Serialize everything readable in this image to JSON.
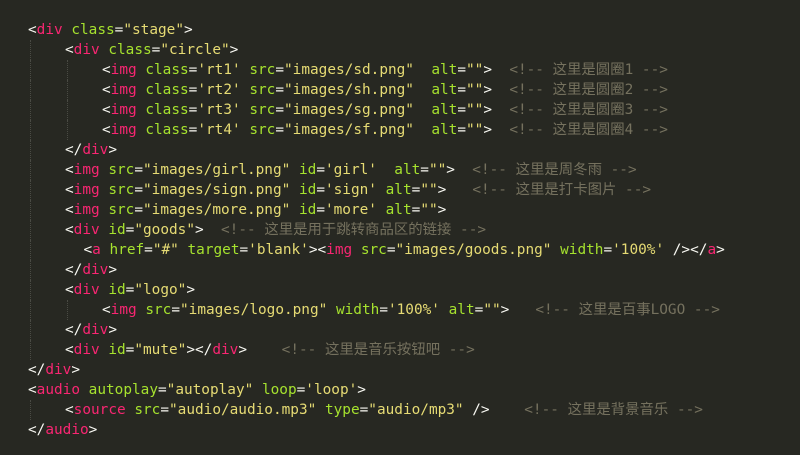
{
  "editor": {
    "language": "html",
    "theme": "monokai",
    "colors": {
      "background": "#272822",
      "tag": "#f92672",
      "attribute": "#a6e22e",
      "string": "#e6db74",
      "comment": "#75715e",
      "text": "#f8f8f2"
    },
    "lines": [
      {
        "indent": 0,
        "tokens": [
          [
            "punc",
            "<"
          ],
          [
            "tag",
            "div"
          ],
          [
            "punc",
            " "
          ],
          [
            "attr",
            "class"
          ],
          [
            "punc",
            "="
          ],
          [
            "str",
            "\"stage\""
          ],
          [
            "punc",
            ">"
          ]
        ]
      },
      {
        "indent": 1,
        "tokens": [
          [
            "punc",
            "<"
          ],
          [
            "tag",
            "div"
          ],
          [
            "punc",
            " "
          ],
          [
            "attr",
            "class"
          ],
          [
            "punc",
            "="
          ],
          [
            "str",
            "\"circle\""
          ],
          [
            "punc",
            ">"
          ]
        ]
      },
      {
        "indent": 2,
        "tokens": [
          [
            "punc",
            "<"
          ],
          [
            "tag",
            "img"
          ],
          [
            "punc",
            " "
          ],
          [
            "attr",
            "class"
          ],
          [
            "punc",
            "="
          ],
          [
            "str",
            "'rt1'"
          ],
          [
            "punc",
            " "
          ],
          [
            "attr",
            "src"
          ],
          [
            "punc",
            "="
          ],
          [
            "str",
            "\"images/sd.png\""
          ],
          [
            "punc",
            "  "
          ],
          [
            "attr",
            "alt"
          ],
          [
            "punc",
            "="
          ],
          [
            "str",
            "\"\""
          ],
          [
            "punc",
            ">"
          ],
          [
            "punc",
            "  "
          ],
          [
            "cmt",
            "<!-- 这里是圆圈1 -->"
          ]
        ]
      },
      {
        "indent": 2,
        "tokens": [
          [
            "punc",
            "<"
          ],
          [
            "tag",
            "img"
          ],
          [
            "punc",
            " "
          ],
          [
            "attr",
            "class"
          ],
          [
            "punc",
            "="
          ],
          [
            "str",
            "'rt2'"
          ],
          [
            "punc",
            " "
          ],
          [
            "attr",
            "src"
          ],
          [
            "punc",
            "="
          ],
          [
            "str",
            "\"images/sh.png\""
          ],
          [
            "punc",
            "  "
          ],
          [
            "attr",
            "alt"
          ],
          [
            "punc",
            "="
          ],
          [
            "str",
            "\"\""
          ],
          [
            "punc",
            ">"
          ],
          [
            "punc",
            "  "
          ],
          [
            "cmt",
            "<!-- 这里是圆圈2 -->"
          ]
        ]
      },
      {
        "indent": 2,
        "tokens": [
          [
            "punc",
            "<"
          ],
          [
            "tag",
            "img"
          ],
          [
            "punc",
            " "
          ],
          [
            "attr",
            "class"
          ],
          [
            "punc",
            "="
          ],
          [
            "str",
            "'rt3'"
          ],
          [
            "punc",
            " "
          ],
          [
            "attr",
            "src"
          ],
          [
            "punc",
            "="
          ],
          [
            "str",
            "\"images/sg.png\""
          ],
          [
            "punc",
            "  "
          ],
          [
            "attr",
            "alt"
          ],
          [
            "punc",
            "="
          ],
          [
            "str",
            "\"\""
          ],
          [
            "punc",
            ">"
          ],
          [
            "punc",
            "  "
          ],
          [
            "cmt",
            "<!-- 这里是圆圈3 -->"
          ]
        ]
      },
      {
        "indent": 2,
        "tokens": [
          [
            "punc",
            "<"
          ],
          [
            "tag",
            "img"
          ],
          [
            "punc",
            " "
          ],
          [
            "attr",
            "class"
          ],
          [
            "punc",
            "="
          ],
          [
            "str",
            "'rt4'"
          ],
          [
            "punc",
            " "
          ],
          [
            "attr",
            "src"
          ],
          [
            "punc",
            "="
          ],
          [
            "str",
            "\"images/sf.png\""
          ],
          [
            "punc",
            "  "
          ],
          [
            "attr",
            "alt"
          ],
          [
            "punc",
            "="
          ],
          [
            "str",
            "\"\""
          ],
          [
            "punc",
            ">"
          ],
          [
            "punc",
            "  "
          ],
          [
            "cmt",
            "<!-- 这里是圆圈4 -->"
          ]
        ]
      },
      {
        "indent": 1,
        "tokens": [
          [
            "punc",
            "</"
          ],
          [
            "tag",
            "div"
          ],
          [
            "punc",
            ">"
          ]
        ]
      },
      {
        "indent": 1,
        "tokens": [
          [
            "punc",
            "<"
          ],
          [
            "tag",
            "img"
          ],
          [
            "punc",
            " "
          ],
          [
            "attr",
            "src"
          ],
          [
            "punc",
            "="
          ],
          [
            "str",
            "\"images/girl.png\""
          ],
          [
            "punc",
            " "
          ],
          [
            "attr",
            "id"
          ],
          [
            "punc",
            "="
          ],
          [
            "str",
            "'girl'"
          ],
          [
            "punc",
            "  "
          ],
          [
            "attr",
            "alt"
          ],
          [
            "punc",
            "="
          ],
          [
            "str",
            "\"\""
          ],
          [
            "punc",
            ">"
          ],
          [
            "punc",
            "  "
          ],
          [
            "cmt",
            "<!-- 这里是周冬雨 -->"
          ]
        ]
      },
      {
        "indent": 1,
        "tokens": [
          [
            "punc",
            "<"
          ],
          [
            "tag",
            "img"
          ],
          [
            "punc",
            " "
          ],
          [
            "attr",
            "src"
          ],
          [
            "punc",
            "="
          ],
          [
            "str",
            "\"images/sign.png\""
          ],
          [
            "punc",
            " "
          ],
          [
            "attr",
            "id"
          ],
          [
            "punc",
            "="
          ],
          [
            "str",
            "'sign'"
          ],
          [
            "punc",
            " "
          ],
          [
            "attr",
            "alt"
          ],
          [
            "punc",
            "="
          ],
          [
            "str",
            "\"\""
          ],
          [
            "punc",
            ">"
          ],
          [
            "punc",
            "   "
          ],
          [
            "cmt",
            "<!-- 这里是打卡图片 -->"
          ]
        ]
      },
      {
        "indent": 1,
        "tokens": [
          [
            "punc",
            "<"
          ],
          [
            "tag",
            "img"
          ],
          [
            "punc",
            " "
          ],
          [
            "attr",
            "src"
          ],
          [
            "punc",
            "="
          ],
          [
            "str",
            "\"images/more.png\""
          ],
          [
            "punc",
            " "
          ],
          [
            "attr",
            "id"
          ],
          [
            "punc",
            "="
          ],
          [
            "str",
            "'more'"
          ],
          [
            "punc",
            " "
          ],
          [
            "attr",
            "alt"
          ],
          [
            "punc",
            "="
          ],
          [
            "str",
            "\"\""
          ],
          [
            "punc",
            ">"
          ]
        ]
      },
      {
        "indent": 1,
        "tokens": [
          [
            "punc",
            "<"
          ],
          [
            "tag",
            "div"
          ],
          [
            "punc",
            " "
          ],
          [
            "attr",
            "id"
          ],
          [
            "punc",
            "="
          ],
          [
            "str",
            "\"goods\""
          ],
          [
            "punc",
            ">"
          ],
          [
            "punc",
            "  "
          ],
          [
            "cmt",
            "<!-- 这里是用于跳转商品区的链接 -->"
          ]
        ]
      },
      {
        "indent": 1.5,
        "tokens": [
          [
            "punc",
            "<"
          ],
          [
            "tag",
            "a"
          ],
          [
            "punc",
            " "
          ],
          [
            "attr",
            "href"
          ],
          [
            "punc",
            "="
          ],
          [
            "str",
            "\"#\""
          ],
          [
            "punc",
            " "
          ],
          [
            "attr",
            "target"
          ],
          [
            "punc",
            "="
          ],
          [
            "str",
            "'blank'"
          ],
          [
            "punc",
            "><"
          ],
          [
            "tag",
            "img"
          ],
          [
            "punc",
            " "
          ],
          [
            "attr",
            "src"
          ],
          [
            "punc",
            "="
          ],
          [
            "str",
            "\"images/goods.png\""
          ],
          [
            "punc",
            " "
          ],
          [
            "attr",
            "width"
          ],
          [
            "punc",
            "="
          ],
          [
            "str",
            "'100%'"
          ],
          [
            "punc",
            " /></"
          ],
          [
            "tag",
            "a"
          ],
          [
            "punc",
            ">"
          ]
        ]
      },
      {
        "indent": 1,
        "tokens": [
          [
            "punc",
            "</"
          ],
          [
            "tag",
            "div"
          ],
          [
            "punc",
            ">"
          ]
        ]
      },
      {
        "indent": 1,
        "tokens": [
          [
            "punc",
            "<"
          ],
          [
            "tag",
            "div"
          ],
          [
            "punc",
            " "
          ],
          [
            "attr",
            "id"
          ],
          [
            "punc",
            "="
          ],
          [
            "str",
            "\"logo\""
          ],
          [
            "punc",
            ">"
          ]
        ]
      },
      {
        "indent": 2,
        "tokens": [
          [
            "punc",
            "<"
          ],
          [
            "tag",
            "img"
          ],
          [
            "punc",
            " "
          ],
          [
            "attr",
            "src"
          ],
          [
            "punc",
            "="
          ],
          [
            "str",
            "\"images/logo.png\""
          ],
          [
            "punc",
            " "
          ],
          [
            "attr",
            "width"
          ],
          [
            "punc",
            "="
          ],
          [
            "str",
            "'100%'"
          ],
          [
            "punc",
            " "
          ],
          [
            "attr",
            "alt"
          ],
          [
            "punc",
            "="
          ],
          [
            "str",
            "\"\""
          ],
          [
            "punc",
            ">"
          ],
          [
            "punc",
            "   "
          ],
          [
            "cmt",
            "<!-- 这里是百事LOGO -->"
          ]
        ]
      },
      {
        "indent": 1,
        "tokens": [
          [
            "punc",
            "</"
          ],
          [
            "tag",
            "div"
          ],
          [
            "punc",
            ">"
          ]
        ]
      },
      {
        "indent": 1,
        "tokens": [
          [
            "punc",
            "<"
          ],
          [
            "tag",
            "div"
          ],
          [
            "punc",
            " "
          ],
          [
            "attr",
            "id"
          ],
          [
            "punc",
            "="
          ],
          [
            "str",
            "\"mute\""
          ],
          [
            "punc",
            "></"
          ],
          [
            "tag",
            "div"
          ],
          [
            "punc",
            ">"
          ],
          [
            "punc",
            "    "
          ],
          [
            "cmt",
            "<!-- 这里是音乐按钮吧 -->"
          ]
        ]
      },
      {
        "indent": 0,
        "tokens": [
          [
            "punc",
            "</"
          ],
          [
            "tag",
            "div"
          ],
          [
            "punc",
            ">"
          ]
        ]
      },
      {
        "indent": 0,
        "tokens": [
          [
            "punc",
            "<"
          ],
          [
            "tag",
            "audio"
          ],
          [
            "punc",
            " "
          ],
          [
            "attr",
            "autoplay"
          ],
          [
            "punc",
            "="
          ],
          [
            "str",
            "\"autoplay\""
          ],
          [
            "punc",
            " "
          ],
          [
            "attr",
            "loop"
          ],
          [
            "punc",
            "="
          ],
          [
            "str",
            "'loop'"
          ],
          [
            "punc",
            ">"
          ]
        ]
      },
      {
        "indent": 1,
        "tokens": [
          [
            "punc",
            "<"
          ],
          [
            "tag",
            "source"
          ],
          [
            "punc",
            " "
          ],
          [
            "attr",
            "src"
          ],
          [
            "punc",
            "="
          ],
          [
            "str",
            "\"audio/audio.mp3\""
          ],
          [
            "punc",
            " "
          ],
          [
            "attr",
            "type"
          ],
          [
            "punc",
            "="
          ],
          [
            "str",
            "\"audio/mp3\""
          ],
          [
            "punc",
            " />"
          ],
          [
            "punc",
            "    "
          ],
          [
            "cmt",
            "<!-- 这里是背景音乐 -->"
          ]
        ]
      },
      {
        "indent": 0,
        "tokens": [
          [
            "punc",
            "</"
          ],
          [
            "tag",
            "audio"
          ],
          [
            "punc",
            ">"
          ]
        ]
      }
    ]
  }
}
